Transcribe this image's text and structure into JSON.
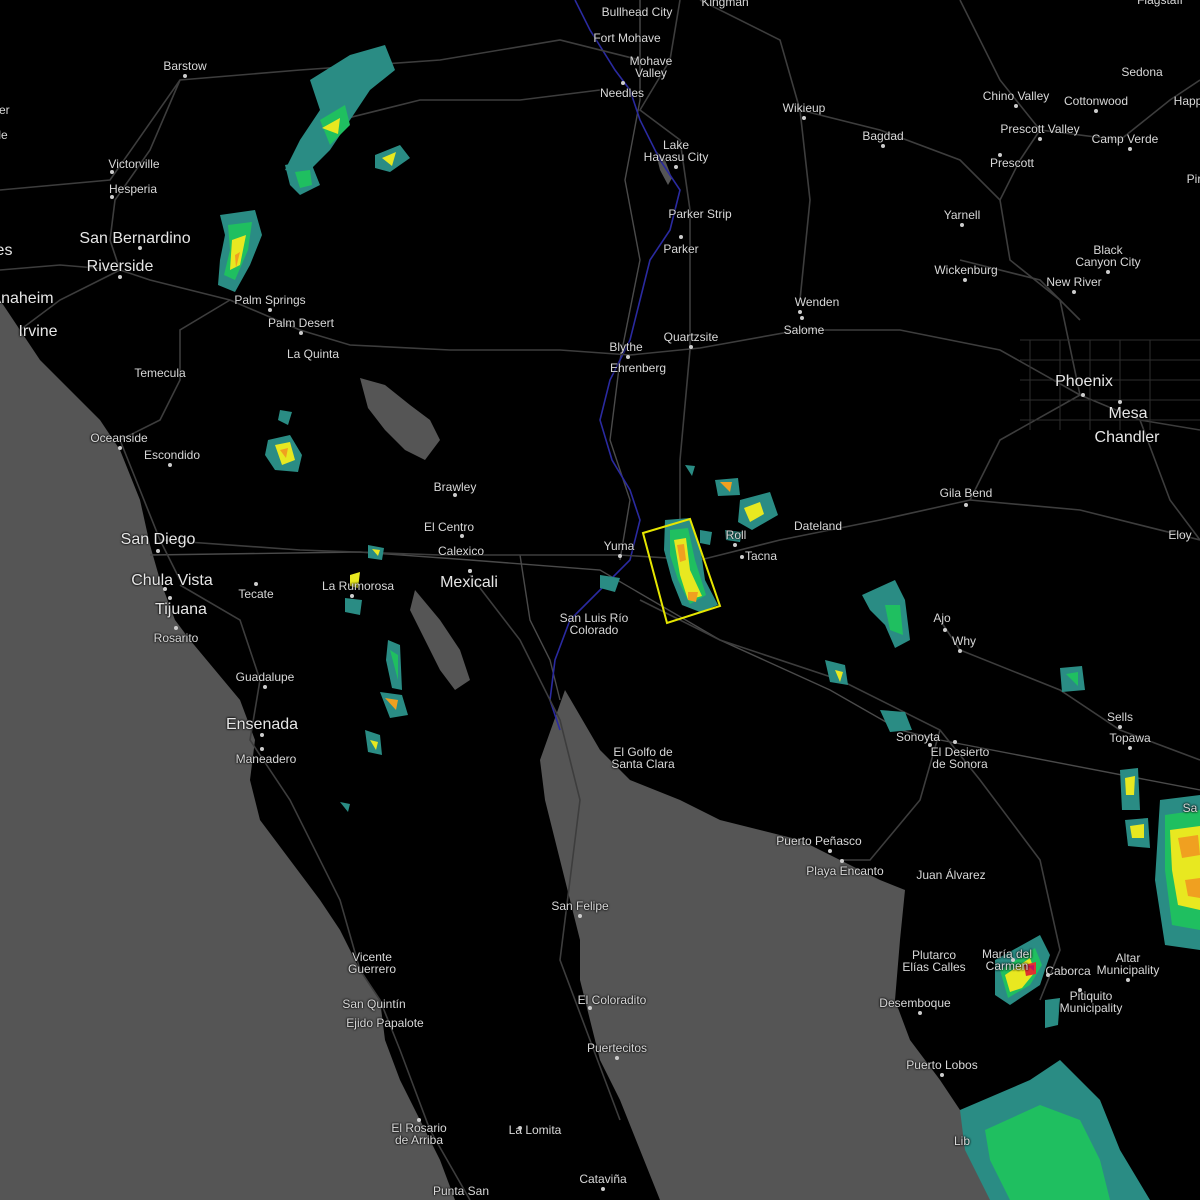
{
  "map": {
    "colors": {
      "land": "#000000",
      "water": "#555555",
      "roads": "#3a3a3a",
      "border": "#4a4a4a",
      "river": "#2a2a8a",
      "labels": "#d8d8d8",
      "warning_box": "#e6e600",
      "radar_light": "#2a8c84",
      "radar_green": "#1fbf60",
      "radar_yellow": "#e8e820",
      "radar_orange": "#f0a020",
      "radar_red": "#e03030",
      "radar_magenta": "#c01060"
    },
    "places": [
      {
        "id": "bullhead-city",
        "name": "Bullhead City"
      },
      {
        "id": "kingman",
        "name": "Kingman"
      },
      {
        "id": "fort-mohave",
        "name": "Fort Mohave"
      },
      {
        "id": "mohave-valley",
        "name": "Mohave\nValley"
      },
      {
        "id": "needles",
        "name": "Needles"
      },
      {
        "id": "barstow",
        "name": "Barstow"
      },
      {
        "id": "victorville",
        "name": "Victorville"
      },
      {
        "id": "hesperia",
        "name": "Hesperia"
      },
      {
        "id": "san-bernardino",
        "name": "San Bernardino"
      },
      {
        "id": "riverside",
        "name": "Riverside"
      },
      {
        "id": "anaheim",
        "name": "Anaheim"
      },
      {
        "id": "irvine",
        "name": "Irvine"
      },
      {
        "id": "palm-springs",
        "name": "Palm Springs"
      },
      {
        "id": "palm-desert",
        "name": "Palm Desert"
      },
      {
        "id": "la-quinta",
        "name": "La Quinta"
      },
      {
        "id": "temecula",
        "name": "Temecula"
      },
      {
        "id": "oceanside",
        "name": "Oceanside"
      },
      {
        "id": "escondido",
        "name": "Escondido"
      },
      {
        "id": "san-diego",
        "name": "San Diego"
      },
      {
        "id": "chula-vista",
        "name": "Chula Vista"
      },
      {
        "id": "tijuana",
        "name": "Tijuana"
      },
      {
        "id": "rosarito",
        "name": "Rosarito"
      },
      {
        "id": "tecate",
        "name": "Tecate"
      },
      {
        "id": "la-rumorosa",
        "name": "La Rumorosa"
      },
      {
        "id": "mexicali",
        "name": "Mexicali"
      },
      {
        "id": "calexico",
        "name": "Calexico"
      },
      {
        "id": "el-centro",
        "name": "El Centro"
      },
      {
        "id": "brawley",
        "name": "Brawley"
      },
      {
        "id": "guadalupe",
        "name": "Guadalupe"
      },
      {
        "id": "ensenada",
        "name": "Ensenada"
      },
      {
        "id": "maneadero",
        "name": "Maneadero"
      },
      {
        "id": "lake-havasu",
        "name": "Lake\nHavasu City"
      },
      {
        "id": "parker-strip",
        "name": "Parker Strip"
      },
      {
        "id": "parker",
        "name": "Parker"
      },
      {
        "id": "wikieup",
        "name": "Wikieup"
      },
      {
        "id": "bagdad",
        "name": "Bagdad"
      },
      {
        "id": "chino-valley",
        "name": "Chino Valley"
      },
      {
        "id": "cottonwood",
        "name": "Cottonwood"
      },
      {
        "id": "sedona",
        "name": "Sedona"
      },
      {
        "id": "flagstaff",
        "name": "Flagstaff"
      },
      {
        "id": "happy-jack",
        "name": "Happ"
      },
      {
        "id": "prescott-valley",
        "name": "Prescott Valley"
      },
      {
        "id": "camp-verde",
        "name": "Camp Verde"
      },
      {
        "id": "prescott",
        "name": "Prescott"
      },
      {
        "id": "yarnell",
        "name": "Yarnell"
      },
      {
        "id": "wickenburg",
        "name": "Wickenburg"
      },
      {
        "id": "black-canyon",
        "name": "Black\nCanyon City"
      },
      {
        "id": "new-river",
        "name": "New River"
      },
      {
        "id": "wenden",
        "name": "Wenden"
      },
      {
        "id": "salome",
        "name": "Salome"
      },
      {
        "id": "quartzsite",
        "name": "Quartzsite"
      },
      {
        "id": "blythe",
        "name": "Blythe"
      },
      {
        "id": "ehrenberg",
        "name": "Ehrenberg"
      },
      {
        "id": "phoenix",
        "name": "Phoenix"
      },
      {
        "id": "mesa",
        "name": "Mesa"
      },
      {
        "id": "chandler",
        "name": "Chandler"
      },
      {
        "id": "gila-bend",
        "name": "Gila Bend"
      },
      {
        "id": "eloy",
        "name": "Eloy"
      },
      {
        "id": "dateland",
        "name": "Dateland"
      },
      {
        "id": "roll",
        "name": "Roll"
      },
      {
        "id": "tacna",
        "name": "Tacna"
      },
      {
        "id": "yuma",
        "name": "Yuma"
      },
      {
        "id": "san-luis",
        "name": "San Luis Río\nColorado"
      },
      {
        "id": "ajo",
        "name": "Ajo"
      },
      {
        "id": "why",
        "name": "Why"
      },
      {
        "id": "sells",
        "name": "Sells"
      },
      {
        "id": "topawa",
        "name": "Topawa"
      },
      {
        "id": "sonoyta",
        "name": "Sonoyta"
      },
      {
        "id": "el-desierto",
        "name": "El Desierto\nde Sonora"
      },
      {
        "id": "el-golfo",
        "name": "El Golfo de\nSanta Clara"
      },
      {
        "id": "puerto-penasco",
        "name": "Puerto Peñasco"
      },
      {
        "id": "playa-encanto",
        "name": "Playa Encanto"
      },
      {
        "id": "juan-alvarez",
        "name": "Juan Álvarez"
      },
      {
        "id": "san-felipe",
        "name": "San Felipe"
      },
      {
        "id": "vicente-guerrero",
        "name": "Vicente\nGuerrero"
      },
      {
        "id": "san-quintin",
        "name": "San Quintín"
      },
      {
        "id": "ejido-papalote",
        "name": "Ejido Papalote"
      },
      {
        "id": "el-coloradito",
        "name": "El Coloradito"
      },
      {
        "id": "puertecitos",
        "name": "Puertecitos"
      },
      {
        "id": "plutarco",
        "name": "Plutarco\nElías Calles"
      },
      {
        "id": "maria-del-carmen",
        "name": "María del\nCarmen"
      },
      {
        "id": "caborca",
        "name": "Caborca"
      },
      {
        "id": "altar",
        "name": "Altar\nMunicipality"
      },
      {
        "id": "pitiquito",
        "name": "Pitiquito\nMunicipality"
      },
      {
        "id": "desemboque",
        "name": "Desemboque"
      },
      {
        "id": "puerto-lobos",
        "name": "Puerto Lobos"
      },
      {
        "id": "el-rosario",
        "name": "El Rosario\nde Arriba"
      },
      {
        "id": "la-lomita",
        "name": "La Lomita"
      },
      {
        "id": "catavina",
        "name": "Cataviña"
      },
      {
        "id": "punta-san",
        "name": "Punta San"
      },
      {
        "id": "edge-ler",
        "name": "ler"
      },
      {
        "id": "edge-le",
        "name": "le"
      },
      {
        "id": "edge-es",
        "name": "es"
      },
      {
        "id": "edge-pir",
        "name": "Pir"
      },
      {
        "id": "edge-lib",
        "name": "Lib"
      },
      {
        "id": "edge-sa",
        "name": "Sa"
      }
    ]
  }
}
